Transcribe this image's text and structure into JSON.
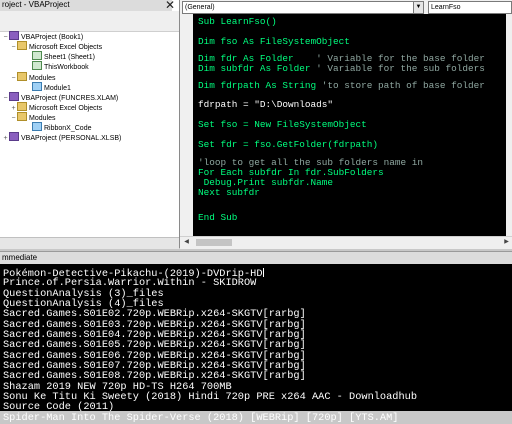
{
  "project": {
    "title": "roject - VBAProject",
    "close_glyph": "✕",
    "nodes": [
      {
        "label": "VBAProject (Book1)",
        "exp": "−",
        "icon": "proj"
      },
      {
        "label": "Microsoft Excel Objects",
        "exp": "−",
        "icon": "folder"
      },
      {
        "label": "Sheet1 (Sheet1)",
        "exp": "",
        "icon": "sheet"
      },
      {
        "label": "ThisWorkbook",
        "exp": "",
        "icon": "sheet"
      },
      {
        "label": "Modules",
        "exp": "−",
        "icon": "folder"
      },
      {
        "label": "Module1",
        "exp": "",
        "icon": "mod"
      },
      {
        "label": "VBAProject (FUNCRES.XLAM)",
        "exp": "−",
        "icon": "proj"
      },
      {
        "label": "Microsoft Excel Objects",
        "exp": "+",
        "icon": "folder"
      },
      {
        "label": "Modules",
        "exp": "−",
        "icon": "folder"
      },
      {
        "label": "RibbonX_Code",
        "exp": "",
        "icon": "mod"
      },
      {
        "label": "VBAProject (PERSONAL.XLSB)",
        "exp": "+",
        "icon": "proj"
      }
    ]
  },
  "code": {
    "object_combo": "(General)",
    "proc_combo": "LearnFso",
    "lines": [
      {
        "parts": [
          {
            "t": "Sub LearnFso()",
            "c": "kw"
          }
        ]
      },
      {
        "parts": [
          {
            "t": "Dim fso As FileSystemObject",
            "c": "kw"
          }
        ]
      },
      {
        "parts": [
          {
            "t": "Dim fdr As Folder    ",
            "c": "kw"
          },
          {
            "t": "' Variable for the base folder",
            "c": "cm"
          }
        ]
      },
      {
        "parts": [
          {
            "t": "Dim subfdr As Folder ",
            "c": "kw"
          },
          {
            "t": "' Variable for the sub folders",
            "c": "cm"
          }
        ]
      },
      {
        "parts": [
          {
            "t": "Dim fdrpath As String ",
            "c": "kw"
          },
          {
            "t": "'to store path of base folder",
            "c": "cm"
          }
        ]
      },
      {
        "parts": [
          {
            "t": "fdrpath = \"D:\\Downloads\"",
            "c": ""
          }
        ]
      },
      {
        "parts": [
          {
            "t": "Set fso = New FileSystemObject",
            "c": "kw"
          }
        ]
      },
      {
        "parts": [
          {
            "t": "Set fdr = fso.GetFolder(fdrpath)",
            "c": "kw"
          }
        ]
      },
      {
        "parts": [
          {
            "t": "'loop to get all the sub folders name in",
            "c": "cm"
          }
        ]
      },
      {
        "parts": [
          {
            "t": "For Each subfdr In fdr.SubFolders",
            "c": "kw"
          }
        ]
      },
      {
        "parts": [
          {
            "t": " Debug.Print subfdr.Name",
            "c": "kw"
          }
        ]
      },
      {
        "parts": [
          {
            "t": "Next subfdr",
            "c": "kw"
          }
        ]
      },
      {
        "parts": [
          {
            "t": "End Sub",
            "c": "kw"
          }
        ]
      }
    ]
  },
  "immediate": {
    "title": "mmediate",
    "lines": [
      "Pokémon-Detective-Pikachu-(2019)-DVDrip-HD",
      "Prince.of.Persia.Warrior.Within - SKIDROW",
      "QuestionAnalysis (3)_files",
      "QuestionAnalysis (4)_files",
      "Sacred.Games.S01E02.720p.WEBRip.x264-SKGTV[rarbg]",
      "Sacred.Games.S01E03.720p.WEBRip.x264-SKGTV[rarbg]",
      "Sacred.Games.S01E04.720p.WEBRip.x264-SKGTV[rarbg]",
      "Sacred.Games.S01E05.720p.WEBRip.x264-SKGTV[rarbg]",
      "Sacred.Games.S01E06.720p.WEBRip.x264-SKGTV[rarbg]",
      "Sacred.Games.S01E07.720p.WEBRip.x264-SKGTV[rarbg]",
      "Sacred.Games.S01E08.720p.WEBRip.x264-SKGTV[rarbg]",
      "Shazam 2019 NEW 720p HD-TS H264 700MB",
      "Sonu Ke Titu Ki Sweety (2018) Hindi 720p PRE x264 AAC - Downloadhub",
      "Source Code (2011)",
      "Spider-Man Into The Spider-Verse (2018) [WEBRip] [720p] [YTS.AM]"
    ]
  }
}
